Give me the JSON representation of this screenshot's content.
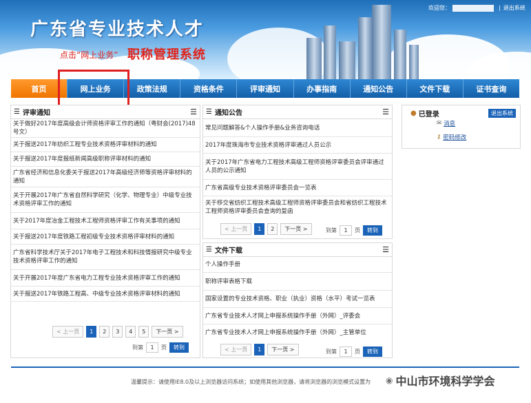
{
  "header": {
    "title": "广东省专业技术人才",
    "system_name": "职称管理系统",
    "hint": "点击“网上业务”",
    "welcome": "欢迎您：",
    "logout": "退出系统"
  },
  "nav": [
    {
      "label": "首页",
      "active": true
    },
    {
      "label": "网上业务"
    },
    {
      "label": "政策法规"
    },
    {
      "label": "资格条件"
    },
    {
      "label": "评审通知"
    },
    {
      "label": "办事指南"
    },
    {
      "label": "通知公告"
    },
    {
      "label": "文件下载"
    },
    {
      "label": "证书查询"
    }
  ],
  "review_notices": {
    "title": "评审通知",
    "items": [
      "关于做好2017年度高级会计师资格评审工作的通知（粤财会(2017)48号文）",
      "关于报送2017年纺织工程专业技术资格评审材料的通知",
      "关于报送2017年度报纸新闻高级职称评审材料的通知",
      "广东省经济和信息化委关于报送2017年高级经济师等资格评审材料的通知",
      "关于开展2017年广东省自然科学研究（化学、物理专业）中级专业技术资格评审工作的通知",
      "关于2017年度冶金工程技术工程师资格评审工作有关事项的通知",
      "关于报送2017年度铁路工程初级专业技术资格评审材料的通知",
      "广东省科学技术厅关于2017年电子工程技术和科技情报研究中级专业技术资格评审工作的通知",
      "关于开展2017年度广东省电力工程专业技术资格评审工作的通知",
      "关于报送2017年铁路工程高、中级专业技术资格评审材料的通知"
    ],
    "pager": {
      "prev": "< 上一页",
      "pages": [
        "1",
        "2",
        "3",
        "4",
        "5"
      ],
      "next": "下一页 >",
      "goto": "到第",
      "page_value": "1",
      "unit": "页",
      "go": "转到"
    }
  },
  "announcements": {
    "title": "通知公告",
    "items": [
      "常见问题解答&个人操作手册&业务咨询电话",
      "2017年度珠海市专业技术资格评审通过人员公示",
      "关于2017年广东省电力工程技术高级工程师资格评审委员会评审通过人员的公示通知",
      "广东省高级专业技术资格评审委员会一览表",
      "关于移交省纺织工程技术高级工程师资格评审委员会和省纺织工程技术工程师资格评审委员会查询的复函"
    ],
    "pager": {
      "prev": "< 上一页",
      "pages": [
        "1",
        "2"
      ],
      "next": "下一页 >",
      "goto": "到第",
      "page_value": "1",
      "unit": "页",
      "go": "转到"
    }
  },
  "downloads": {
    "title": "文件下载",
    "items": [
      "个人操作手册",
      "职称评审表格下载",
      "国家设置的专业技术资格、职业（执业）资格（水平）考试一览表",
      "广东省专业技术人才网上申报系统操作手册（外网）_评委会",
      "广东省专业技术人才网上申报系统操作手册（外网）_主管单位"
    ],
    "pager": {
      "prev": "< 上一页",
      "pages": [
        "1"
      ],
      "next": "下一页 >",
      "goto": "到第",
      "page_value": "1",
      "unit": "页",
      "go": "转到"
    }
  },
  "user": {
    "status": "已登录",
    "logout": "退出系统",
    "message": "消息",
    "change_password": "密码修改"
  },
  "footer": {
    "text": "温馨提示：请使用IE8.0及以上浏览器访问系统；如使用其他浏览器，请将浏览器的浏览模式设置为"
  },
  "watermark": "中山市环境科学学会",
  "colors": {
    "nav_blue": "#1a63b8",
    "nav_active": "#f07400",
    "highlight_red": "#e02020"
  }
}
